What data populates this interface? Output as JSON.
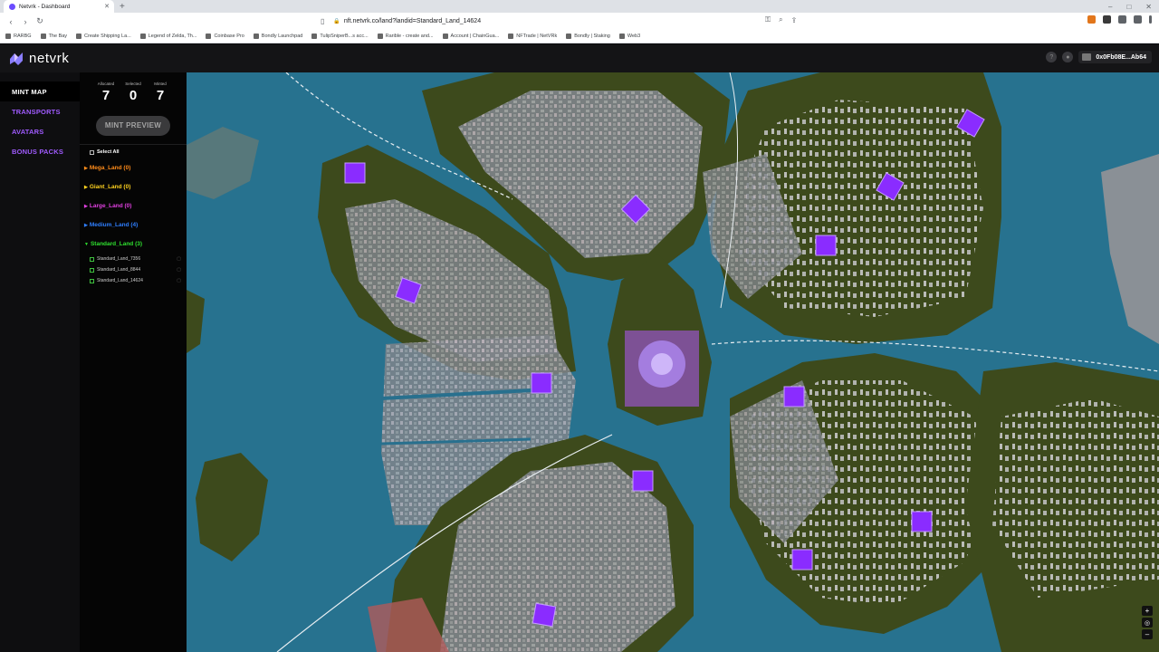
{
  "browser": {
    "tab_title": "Netvrk - Dashboard",
    "url": "nft.netvrk.co/land?landid=Standard_Land_14624",
    "bookmarks": [
      "RARBG",
      "The Bay",
      "Create Shipping La...",
      "Legend of Zelda, Th...",
      "Coinbase Pro",
      "Bondly Launchpad",
      "TulipSniperB...s acc...",
      "Rarible - create and...",
      "Account | ChainGua...",
      "NFTrade | NetVRk",
      "Bondly | Staking",
      "Web3"
    ]
  },
  "header": {
    "logo_text": "netvrk",
    "wallet": "0x0Fb08E...Ab64"
  },
  "nav": {
    "items": [
      "MINT MAP",
      "TRANSPORTS",
      "AVATARS",
      "BONUS PACKS"
    ]
  },
  "stats": {
    "allocated_label": "Allocated",
    "allocated": "7",
    "selected_label": "Selected",
    "selected": "0",
    "minted_label": "Minted",
    "minted": "7"
  },
  "mint_preview_label": "MINT PREVIEW",
  "select_all_label": "Select All",
  "categories": [
    {
      "label": "Mega_Land (0)",
      "color": "#ff8c1a"
    },
    {
      "label": "Giant_Land (0)",
      "color": "#ffd21f"
    },
    {
      "label": "Large_Land (0)",
      "color": "#e040e0"
    },
    {
      "label": "Medium_Land (4)",
      "color": "#2f7fff"
    },
    {
      "label": "Standard_Land (3)",
      "color": "#2fe02f"
    }
  ],
  "standard_items": [
    "Standard_Land_7356",
    "Standard_Land_8844",
    "Standard_Land_14624"
  ],
  "colors": {
    "water": "#27728f",
    "land": "#3d4a1c",
    "urban": "#8b8f93",
    "parcel": "#8a2cff",
    "accent": "#a05bff"
  },
  "icons": {
    "back": "arrow-left-icon",
    "forward": "arrow-right-icon",
    "reload": "reload-icon",
    "help": "question-icon",
    "profile": "user-icon",
    "zoom_in": "plus-icon",
    "locate": "target-icon",
    "zoom_out": "minus-icon"
  }
}
